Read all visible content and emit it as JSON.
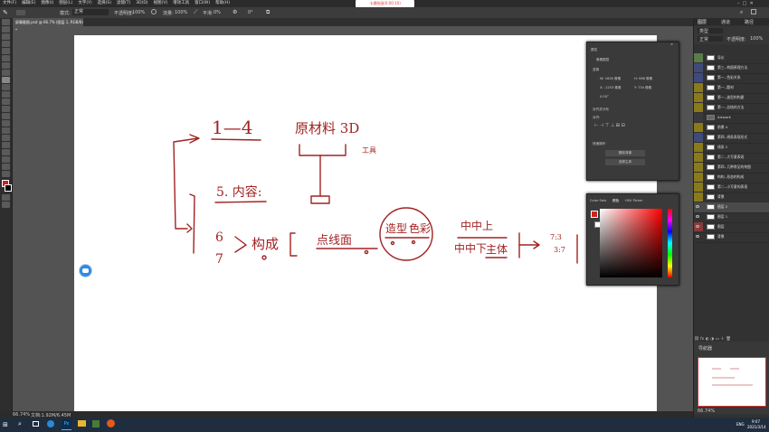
{
  "menubar": {
    "items": [
      "文件(F)",
      "编辑(E)",
      "图像(I)",
      "图层(L)",
      "文字(Y)",
      "选择(S)",
      "滤镜(T)",
      "3D(D)",
      "视图(V)",
      "增效工具",
      "窗口(W)",
      "帮助(H)"
    ]
  },
  "watermark": "卡通绘画(0:00:10)",
  "optionsbar": {
    "mode_label": "模式:",
    "mode_value": "正常",
    "opacity_label": "不透明度:",
    "opacity_value": "100%",
    "flow_label": "流量:",
    "flow_value": "100%",
    "smooth_label": "平滑:",
    "smooth_value": "0%",
    "angle_value": "0°"
  },
  "document_tab": {
    "title": "屏幕截图.psd @ 66.7% (图层 1, RGB/8) *"
  },
  "canvas": {
    "ink_texts": {
      "t1": "1—4",
      "t2": "原材料 3D",
      "t3": "工具",
      "t4": "5. 内容:",
      "t5": "6",
      "t6": "7",
      "t7": "构成",
      "t8": "点线面",
      "t9": "造型",
      "t10": "色彩",
      "t11": "中中上",
      "t12": "中中下",
      "t13": "主体",
      "t14": "7:3",
      "t15": "3:7"
    }
  },
  "statusbar": {
    "zoom": "66.74%",
    "doc": "文档:1.92M/6.45M"
  },
  "properties_panel": {
    "title": "属性",
    "subtitle": "像素图层",
    "section_transform": "变换",
    "w": "W: 1626 像素",
    "h": "H: 966 像素",
    "x": "X: -1253 像素",
    "y": "Y: 734 像素",
    "angle": "0.00°",
    "section_align": "对齐并分布",
    "align_label": "对齐:",
    "section_quick": "快速操作",
    "btn_remove": "删除背景",
    "btn_select": "选择主体"
  },
  "color_panel": {
    "tabs": [
      "Color Sets",
      "颜色",
      "HSV Picker"
    ],
    "active_tab": "颜色"
  },
  "layers_panel": {
    "tabs": [
      "图层",
      "通道",
      "路径"
    ],
    "kind_label": "类型",
    "mode_value": "正常",
    "opacity_label": "不透明度:",
    "opacity_value": "100%",
    "fill_label": "填充:",
    "fill_value": "100%",
    "layers": [
      {
        "name": "导论",
        "color": "#5a7c4a",
        "visible": false
      },
      {
        "name": "第三--构图原理方法",
        "color": "#3e4a7a",
        "visible": false
      },
      {
        "name": "第一--色彩关系",
        "color": "#3e4a7a",
        "visible": false
      },
      {
        "name": "第一--题材",
        "color": "#8a7a1c",
        "visible": false
      },
      {
        "name": "第一--造型的构建",
        "color": "#8a7a1c",
        "visible": false
      },
      {
        "name": "第一--总结的方法",
        "color": "#8a7a1c",
        "visible": false
      },
      {
        "name": "Artwork",
        "color": "#3a3a3a",
        "visible": false
      },
      {
        "name": "前景 4",
        "color": "#8a7a1c",
        "visible": false
      },
      {
        "name": "第四--线条表现形式",
        "color": "#3e4a7a",
        "visible": false
      },
      {
        "name": "线条 2",
        "color": "#8a7a1c",
        "visible": false
      },
      {
        "name": "第二--大写意表现",
        "color": "#8a7a1c",
        "visible": false
      },
      {
        "name": "第四--几种常见的构图",
        "color": "#8a7a1c",
        "visible": false
      },
      {
        "name": "构构--形态的构成",
        "color": "#8a7a1c",
        "visible": false
      },
      {
        "name": "第二--小写意的表现",
        "color": "#8a7a1c",
        "visible": false
      },
      {
        "name": "背景",
        "color": "#8a7a1c",
        "visible": false
      },
      {
        "name": "图层 2",
        "color": "#5a6a8a",
        "visible": true
      },
      {
        "name": "图层 1",
        "color": "#3a3a3a",
        "visible": true
      },
      {
        "name": "图层",
        "color": "#8a3a3a",
        "visible": true
      },
      {
        "name": "背景",
        "color": "#3a3a3a",
        "visible": true
      }
    ]
  },
  "navigator": {
    "title": "导航器",
    "zoom": "66.74%"
  },
  "taskbar": {
    "ime": "ENG",
    "time": "9:07",
    "date": "2021/3/14"
  }
}
